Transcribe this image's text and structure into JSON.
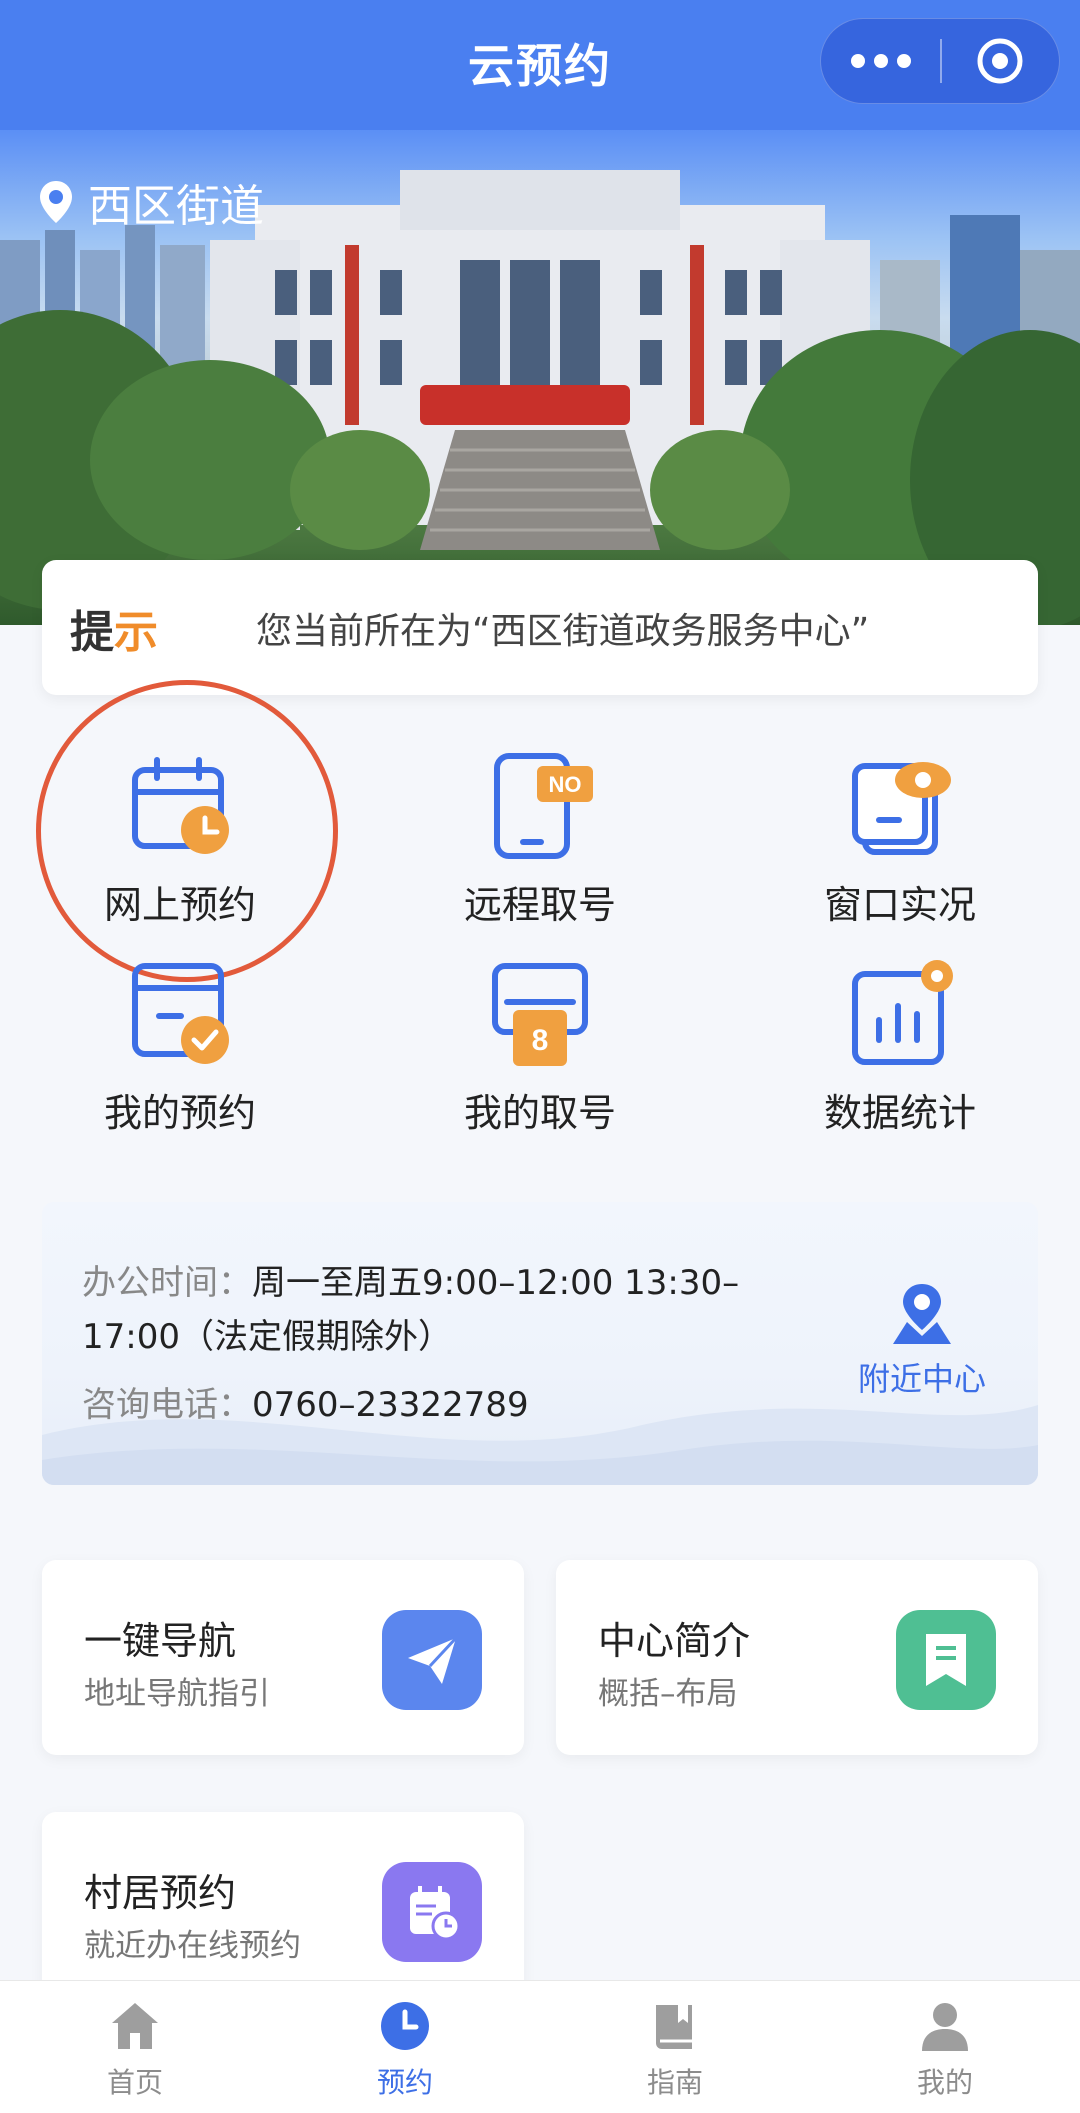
{
  "header": {
    "title": "云预约"
  },
  "banner": {
    "location": "西区街道"
  },
  "tip": {
    "label": "提示",
    "text": "您当前所在为“西区街道政务服务中心”"
  },
  "grid": [
    {
      "label": "网上预约",
      "icon": "calendar-clock-icon"
    },
    {
      "label": "远程取号",
      "icon": "phone-ticket-icon"
    },
    {
      "label": "窗口实况",
      "icon": "window-eye-icon"
    },
    {
      "label": "我的预约",
      "icon": "calendar-check-icon"
    },
    {
      "label": "我的取号",
      "icon": "ticket-number-icon"
    },
    {
      "label": "数据统计",
      "icon": "bar-chart-icon"
    }
  ],
  "grid_ticket_number": "8",
  "grid_no_badge": "NO",
  "office": {
    "hours_label": "办公时间：",
    "hours_value": "周一至周五9:00–12:00 13:30–",
    "hours_value2": "17:00（法定假期除外）",
    "phone_label": "咨询电话：",
    "phone_value": "0760–23322789",
    "nearby_label": "附近中心"
  },
  "services": [
    {
      "title": "一键导航",
      "subtitle": "地址导航指引",
      "icon": "paper-plane-icon",
      "color": "#5b86ee"
    },
    {
      "title": "中心简介",
      "subtitle": "概括–布局",
      "icon": "bookmark-note-icon",
      "color": "#4fbf93"
    },
    {
      "title": "村居预约",
      "subtitle": "就近办在线预约",
      "icon": "schedule-clock-icon",
      "color": "#8a78f0"
    }
  ],
  "tabs": [
    {
      "label": "首页",
      "icon": "home-icon"
    },
    {
      "label": "预约",
      "icon": "clock-icon",
      "active": true
    },
    {
      "label": "指南",
      "icon": "book-icon"
    },
    {
      "label": "我的",
      "icon": "user-icon"
    }
  ],
  "colors": {
    "primary": "#4a7ff0",
    "accent": "#f0a040",
    "highlight": "#e25a3b",
    "link": "#3d6fe6"
  }
}
